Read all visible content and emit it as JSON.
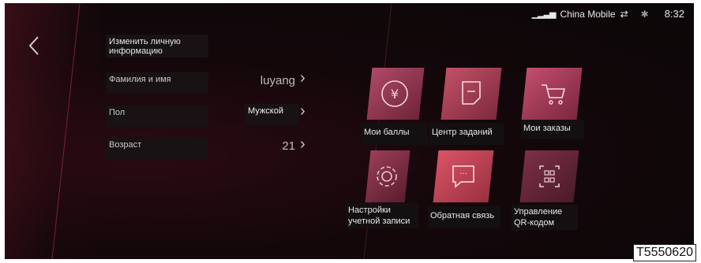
{
  "status_bar": {
    "signal_icon": "signal-bars-icon",
    "carrier": "China Mobile",
    "usb_icon": "usb-icon",
    "bluetooth_icon": "bluetooth-icon",
    "time": "8:32"
  },
  "back_icon": "chevron-left-icon",
  "profile": {
    "edit_title": "Изменить            личную информацию",
    "rows": [
      {
        "label": "Фамилия и имя",
        "value": "luyang"
      },
      {
        "label": "Пол",
        "value": "Мужской"
      },
      {
        "label": "Возраст",
        "value": "21"
      }
    ]
  },
  "tiles": [
    {
      "label": "Мои баллы",
      "icon": "yen-circle-icon"
    },
    {
      "label": "Центр заданий",
      "icon": "note-icon"
    },
    {
      "label": "Мои заказы",
      "icon": "shopping-cart-icon"
    },
    {
      "label": "Настройки учетной записи",
      "icon": "gear-icon"
    },
    {
      "label": "Обратная связь",
      "icon": "chat-bubble-icon"
    },
    {
      "label": "Управление QR-кодом",
      "icon": "qr-code-icon"
    }
  ],
  "stamp": "T5550620"
}
